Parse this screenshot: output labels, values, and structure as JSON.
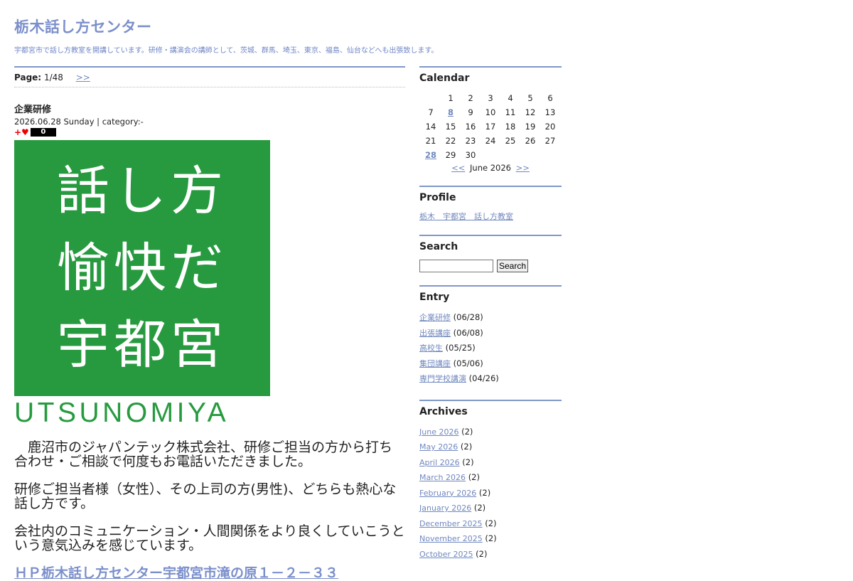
{
  "site": {
    "title": "栃木話し方センター",
    "description": "宇都宮市で話し方教室を開講しています。研修・講演会の講師として、茨城、群馬、埼玉、東京、福島、仙台などへも出張致します。"
  },
  "pager": {
    "label": "Page:",
    "value": "1/48",
    "next": ">>"
  },
  "entry": {
    "title": "企業研修",
    "meta": "2026.06.28 Sunday | category:-",
    "like_icons": "+♥",
    "like_count": "0",
    "logo": {
      "line1": "話し方",
      "line2": "愉快だ",
      "line3": "宇都宮",
      "word": "UTSUNOMIYA"
    },
    "paragraphs": [
      "鹿沼市のジャパンテック株式会社、研修ご担当の方から打ち合わせ・ご相談で何度もお電話いただきました。",
      "研修ご担当者様（女性）、その上司の方(男性)、どちらも熱心な話し方です。",
      "会社内のコミュニケーション・人間関係をより良くしていこうという意気込みを感じています。"
    ],
    "hp_link": "ＨＰ栃木話し方センター宇都宮市滝の原１－２－３３"
  },
  "sidebar": {
    "calendar": {
      "heading": "Calendar",
      "weeks": [
        [
          "",
          "",
          "1",
          "2",
          "3",
          "4",
          "5",
          "6"
        ],
        [
          "7",
          "8",
          "9",
          "10",
          "11",
          "12",
          "13"
        ],
        [
          "14",
          "15",
          "16",
          "17",
          "18",
          "19",
          "20"
        ],
        [
          "21",
          "22",
          "23",
          "24",
          "25",
          "26",
          "27"
        ],
        [
          "28",
          "29",
          "30",
          "",
          "",
          "",
          ""
        ]
      ],
      "linked_days": [
        "8",
        "28"
      ],
      "prev": "<<",
      "month": "June 2026",
      "next": ">>"
    },
    "profile": {
      "heading": "Profile",
      "link": "栃木　宇都宮　話し方教室"
    },
    "search": {
      "heading": "Search",
      "button": "Search",
      "value": ""
    },
    "entry_list": {
      "heading": "Entry",
      "items": [
        {
          "title": "企業研修",
          "date": "(06/28)"
        },
        {
          "title": "出張講座",
          "date": "(06/08)"
        },
        {
          "title": "高校生",
          "date": "(05/25)"
        },
        {
          "title": "集団講座",
          "date": "(05/06)"
        },
        {
          "title": "専門学校講演",
          "date": "(04/26)"
        }
      ]
    },
    "archives": {
      "heading": "Archives",
      "items": [
        {
          "month": "June 2026",
          "count": "(2)"
        },
        {
          "month": "May 2026",
          "count": "(2)"
        },
        {
          "month": "April 2026",
          "count": "(2)"
        },
        {
          "month": "March 2026",
          "count": "(2)"
        },
        {
          "month": "February 2026",
          "count": "(2)"
        },
        {
          "month": "January 2026",
          "count": "(2)"
        },
        {
          "month": "December 2025",
          "count": "(2)"
        },
        {
          "month": "November 2025",
          "count": "(2)"
        },
        {
          "month": "October 2025",
          "count": "(2)"
        }
      ]
    }
  }
}
